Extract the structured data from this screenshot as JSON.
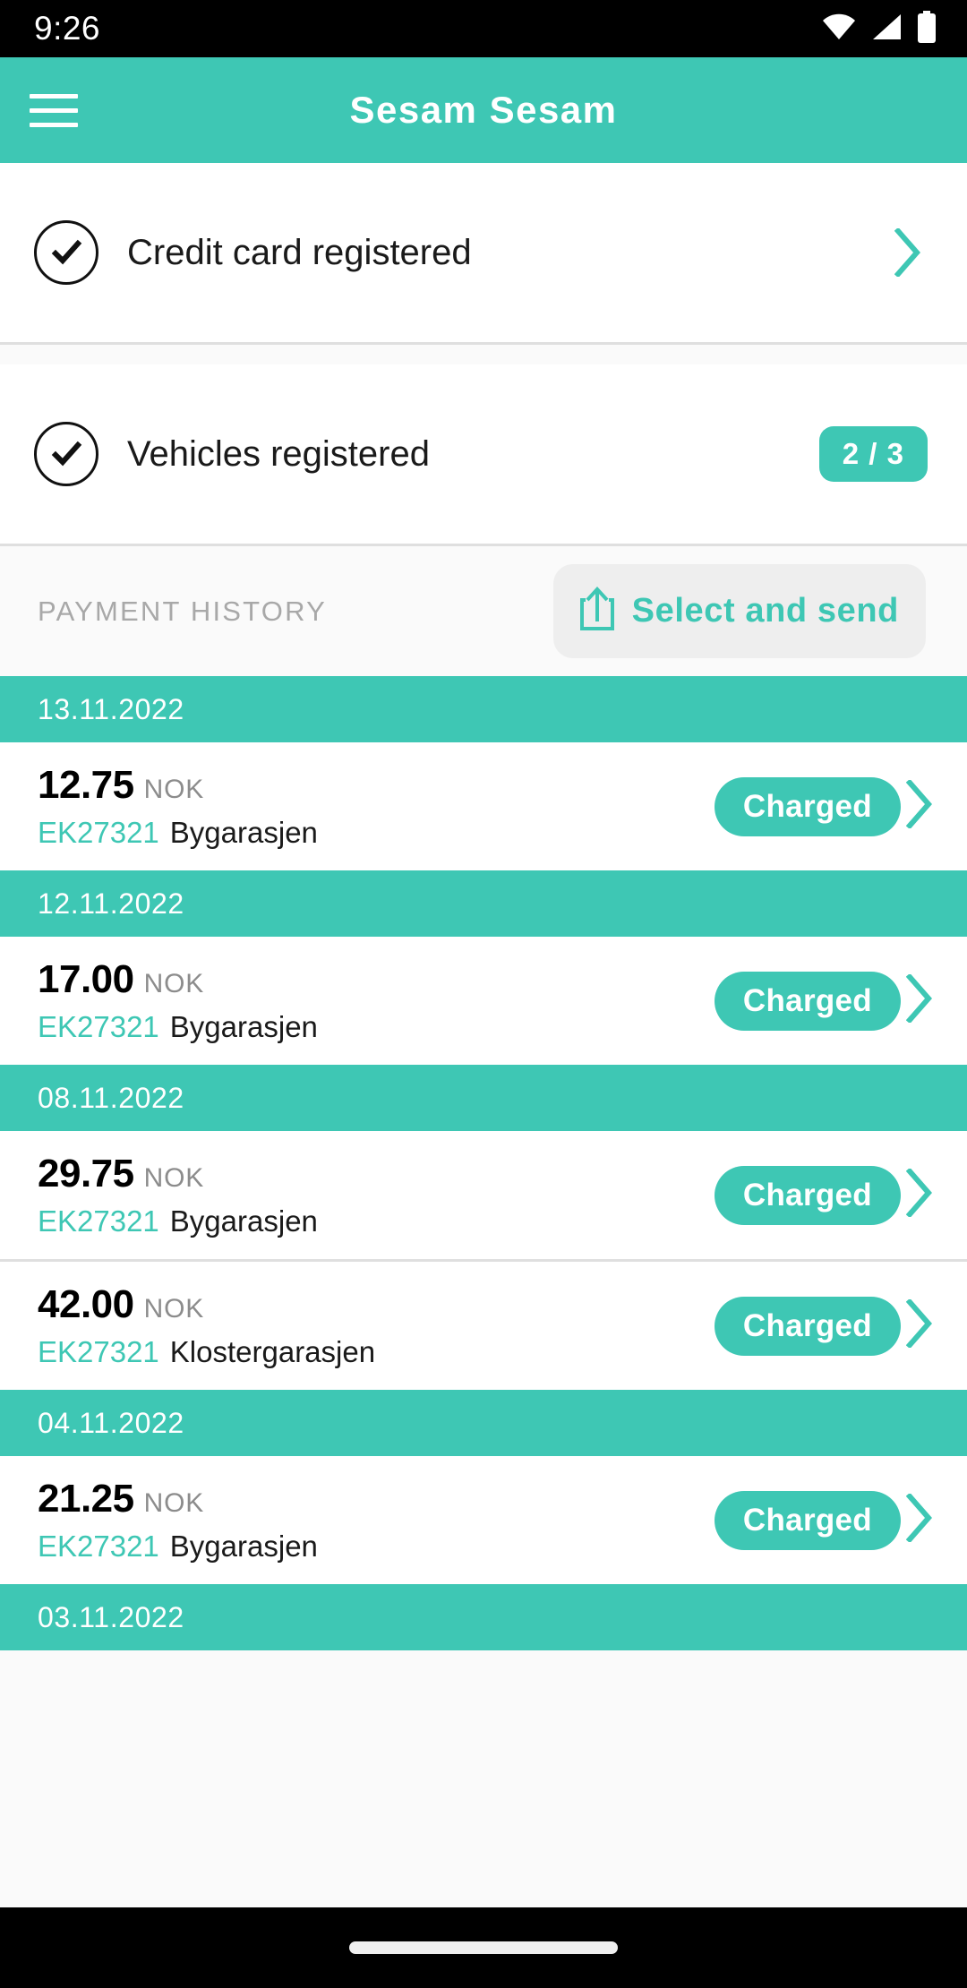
{
  "status_bar": {
    "time": "9:26",
    "icons": [
      "wifi-icon",
      "signal-icon",
      "battery-icon"
    ]
  },
  "app_bar": {
    "menu_icon": "hamburger-menu-icon",
    "title": "Sesam Sesam"
  },
  "status_items": [
    {
      "icon": "check-circle-icon",
      "label": "Credit card registered",
      "accessory": "chevron-right-icon",
      "badge": null
    },
    {
      "icon": "check-circle-icon",
      "label": "Vehicles registered",
      "accessory": null,
      "badge": "2 / 3"
    }
  ],
  "payment_history": {
    "section_title": "PAYMENT HISTORY",
    "send_button": {
      "icon": "share-upload-icon",
      "label": "Select and send"
    }
  },
  "transaction_groups": [
    {
      "date": "13.11.2022",
      "transactions": [
        {
          "amount": "12.75",
          "currency": "NOK",
          "plate": "EK27321",
          "location": "Bygarasjen",
          "status": "Charged",
          "accessory": "chevron-right-icon"
        }
      ]
    },
    {
      "date": "12.11.2022",
      "transactions": [
        {
          "amount": "17.00",
          "currency": "NOK",
          "plate": "EK27321",
          "location": "Bygarasjen",
          "status": "Charged",
          "accessory": "chevron-right-icon"
        }
      ]
    },
    {
      "date": "08.11.2022",
      "transactions": [
        {
          "amount": "29.75",
          "currency": "NOK",
          "plate": "EK27321",
          "location": "Bygarasjen",
          "status": "Charged",
          "accessory": "chevron-right-icon"
        },
        {
          "amount": "42.00",
          "currency": "NOK",
          "plate": "EK27321",
          "location": "Klostergarasjen",
          "status": "Charged",
          "accessory": "chevron-right-icon"
        }
      ]
    },
    {
      "date": "04.11.2022",
      "transactions": [
        {
          "amount": "21.25",
          "currency": "NOK",
          "plate": "EK27321",
          "location": "Bygarasjen",
          "status": "Charged",
          "accessory": "chevron-right-icon"
        }
      ]
    },
    {
      "date": "03.11.2022",
      "transactions": []
    }
  ],
  "colors": {
    "brand_teal": "#3ec7b4",
    "status_bar_bg": "#000000",
    "page_bg": "#fafafa",
    "card_bg": "#ffffff",
    "muted_text": "#a8a8a8",
    "currency_text": "#8c8c8c"
  },
  "nav_bar": {
    "gesture_pill": "home-gesture-pill"
  }
}
